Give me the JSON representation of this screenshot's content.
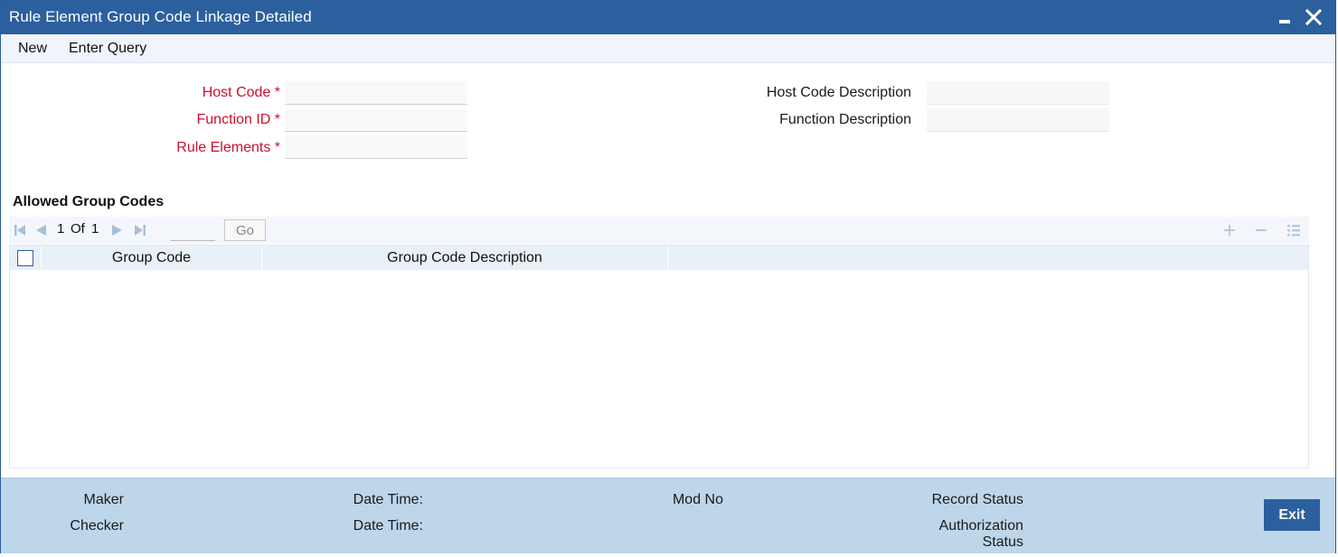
{
  "window": {
    "title": "Rule Element Group Code Linkage Detailed"
  },
  "menu": {
    "new_label": "New",
    "enter_query_label": "Enter Query"
  },
  "form": {
    "host_code_label": "Host Code",
    "function_id_label": "Function ID",
    "rule_elements_label": "Rule Elements",
    "required_marker": "*",
    "host_code_description_label": "Host Code Description",
    "function_description_label": "Function Description",
    "host_code_value": "",
    "function_id_value": "",
    "rule_elements_value": "",
    "host_code_description_value": "",
    "function_description_value": ""
  },
  "section": {
    "title": "Allowed Group Codes",
    "pager": {
      "current_page": "1",
      "of_label": "Of",
      "total_pages": "1",
      "page_input_value": "",
      "go_label": "Go"
    },
    "columns": [
      "Group Code",
      "Group Code Description"
    ],
    "rows": []
  },
  "footer": {
    "maker_label": "Maker",
    "checker_label": "Checker",
    "date_time_label": "Date Time:",
    "mod_no_label": "Mod No",
    "record_status_label": "Record Status",
    "authorization_label": "Authorization",
    "status_label": "Status",
    "exit_label": "Exit"
  },
  "colors": {
    "title_bar": "#2c5f9e",
    "required_text": "#c8102e",
    "footer_bg": "#bdd6ea",
    "menu_bg": "#f0f5fb",
    "grid_header_bg": "#e8f0f8"
  }
}
